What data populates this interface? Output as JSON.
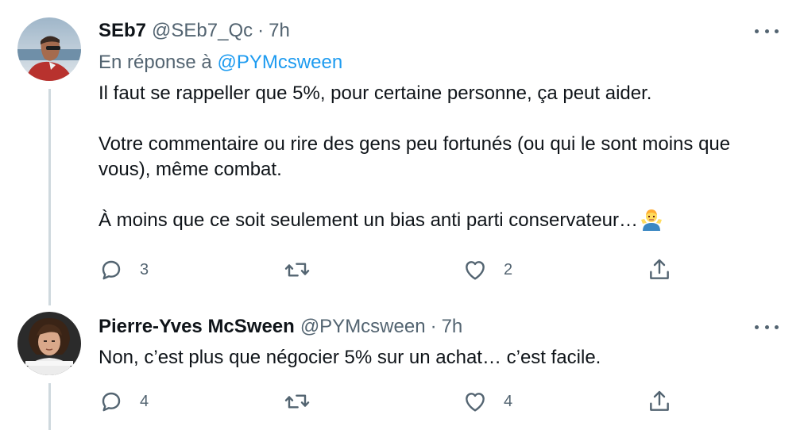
{
  "tweets": [
    {
      "name": "SEb7",
      "handle": "@SEb7_Qc",
      "separator": "·",
      "time": "7h",
      "reply_prefix": "En réponse à",
      "reply_mention": "@PYMcsween",
      "text": "Il faut se rappeller que 5%, pour certaine personne, ça peut aider.\n\nVotre commentaire ou rire des gens peu fortunés (ou qui le sont moins que vous), même combat.\n\nÀ moins que ce soit seulement un bias anti parti conservateur…",
      "emoji_icon": "man-shrugging-emoji",
      "reply_count": "3",
      "like_count": "2",
      "icons": [
        "reply-icon",
        "retweet-icon",
        "like-icon",
        "share-icon",
        "more-icon"
      ]
    },
    {
      "name": "Pierre-Yves McSween",
      "handle": "@PYMcsween",
      "separator": "·",
      "time": "7h",
      "text": "Non, c’est plus que négocier 5% sur un achat… c’est facile.",
      "reply_count": "4",
      "like_count": "4",
      "icons": [
        "reply-icon",
        "retweet-icon",
        "like-icon",
        "share-icon",
        "more-icon"
      ]
    }
  ],
  "colors": {
    "text": "#0f1419",
    "secondary": "#536471",
    "link": "#1d9bf0",
    "thread_line": "#cfd9de"
  }
}
